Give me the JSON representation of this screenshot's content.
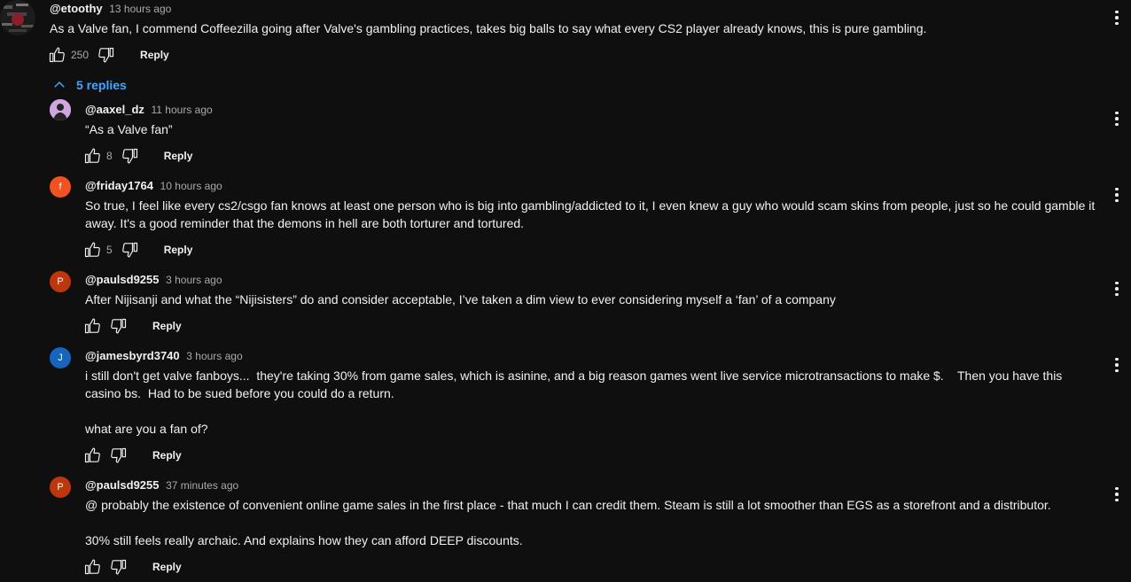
{
  "top_comment": {
    "handle": "@etoothy",
    "time": "13 hours ago",
    "text": "As a Valve fan, I commend Coffeezilla going after Valve's gambling practices, takes big balls to say what every CS2 player already knows, this is pure gambling.",
    "likes": "250",
    "reply_label": "Reply"
  },
  "replies_toggle": {
    "label": "5 replies"
  },
  "replies": [
    {
      "handle": "@aaxel_dz",
      "time": "11 hours ago",
      "text": "“As a Valve fan”",
      "likes": "8",
      "reply_label": "Reply"
    },
    {
      "handle": "@friday1764",
      "time": "10 hours ago",
      "text": "So true, I feel like every cs2/csgo fan knows at least one person who is big into gambling/addicted to it, I even knew a guy who would scam skins from people, just so he could gamble it away. It's a good reminder that the demons in hell are both torturer and tortured.",
      "likes": "5",
      "reply_label": "Reply",
      "avatar_letter": "f",
      "avatar_color": "#f4511e"
    },
    {
      "handle": "@paulsd9255",
      "time": "3 hours ago",
      "text": "After Nijisanji and what the “Nijisisters” do and consider acceptable, I’ve taken a dim view to ever considering myself a ‘fan’ of a company",
      "likes": "",
      "reply_label": "Reply",
      "avatar_letter": "P",
      "avatar_color": "#bf360c"
    },
    {
      "handle": "@jamesbyrd3740",
      "time": "3 hours ago",
      "text": "i still don't get valve fanboys...  they're taking 30% from game sales, which is asinine, and a big reason games went live service microtransactions to make $.    Then you have this casino bs.  Had to be sued before you could do a return.\n\nwhat are you a fan of?",
      "likes": "",
      "reply_label": "Reply",
      "avatar_letter": "J",
      "avatar_color": "#1565c0"
    },
    {
      "handle": "@paulsd9255",
      "time": "37 minutes ago",
      "text": "@ probably the existence of convenient online game sales in the first place - that much I can credit them. Steam is still a lot smoother than EGS as a storefront and a distributor.\n\n30% still feels really archaic. And explains how they can afford DEEP discounts.",
      "likes": "",
      "reply_label": "Reply",
      "avatar_letter": "P",
      "avatar_color": "#bf360c"
    }
  ]
}
